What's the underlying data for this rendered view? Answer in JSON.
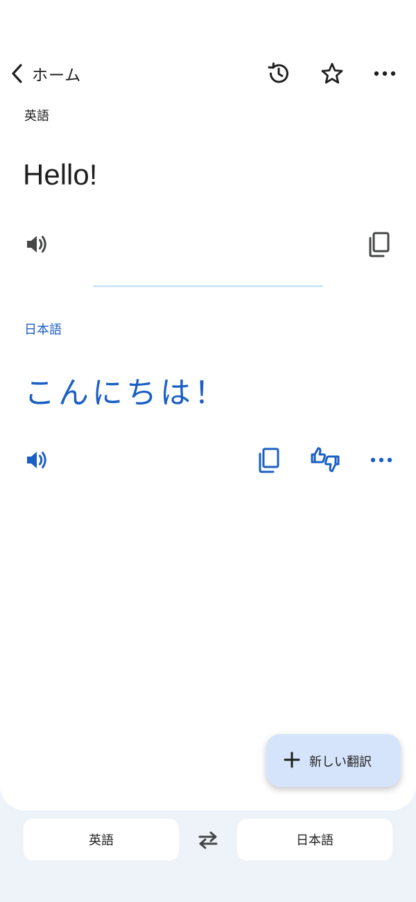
{
  "topbar": {
    "back_label": "ホーム"
  },
  "source": {
    "language": "英語",
    "text": "Hello!"
  },
  "target": {
    "language": "日本語",
    "text": "こんにちは！"
  },
  "fab": {
    "label": "新しい翻訳"
  },
  "language_bar": {
    "source_language": "英語",
    "target_language": "日本語"
  },
  "colors": {
    "accent": "#1a5fc4",
    "text": "#1f1f1f",
    "icon_gray": "#444746",
    "fab_bg": "#d6e4fb",
    "bottom_bg": "#eef3fa"
  },
  "icons": [
    "chevron-left-icon",
    "history-icon",
    "star-icon",
    "more-horiz-icon",
    "speaker-icon",
    "copy-icon",
    "feedback-thumbs-icon",
    "plus-icon",
    "swap-icon"
  ]
}
